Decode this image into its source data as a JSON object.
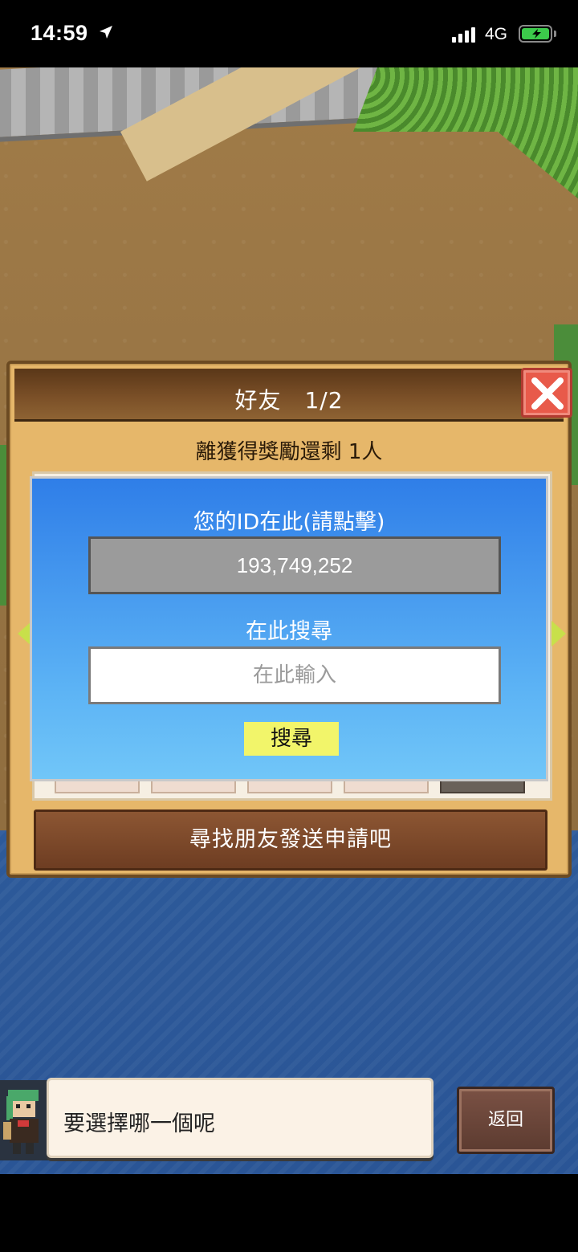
{
  "status_bar": {
    "time": "14:59",
    "network": "4G",
    "location_icon": "location-arrow-icon",
    "battery_icon": "battery-charging-icon",
    "signal_icon": "cellular-signal-icon"
  },
  "friends_panel": {
    "title": "好友　1/2",
    "reward_remaining": "離獲得獎勵還剩 1人",
    "request_button_label": "尋找朋友發送申請吧"
  },
  "id_dialog": {
    "id_label": "您的ID在此(請點擊)",
    "user_id": "193,749,252",
    "search_label": "在此搜尋",
    "search_placeholder": "在此輸入",
    "search_button_label": "搜尋"
  },
  "message_bar": {
    "speech": "要選擇哪一個呢",
    "back_button_label": "返回"
  },
  "colors": {
    "dialog_blue": "#2f7ee8",
    "search_button_yellow": "#f2f56a",
    "close_button_red": "#e85a4a",
    "panel_header_brown": "#6e3d22"
  }
}
